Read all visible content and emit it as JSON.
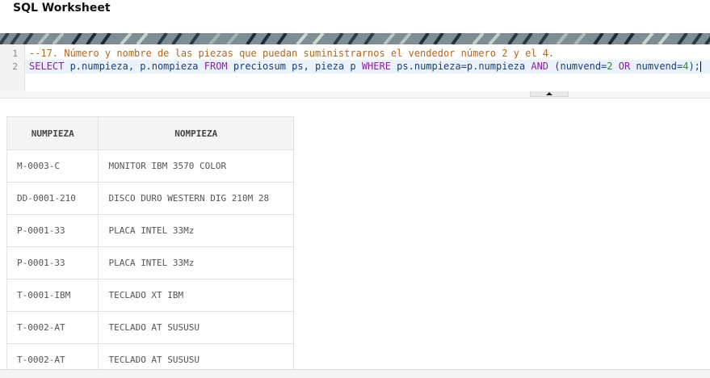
{
  "title": "SQL Worksheet",
  "editor": {
    "line_numbers": [
      "1",
      "2"
    ],
    "line1": "--17. Número y nombre de las piezas que puedan suministrarnos el vendedor número 2 y el 4.",
    "line2": {
      "kw_select": "SELECT",
      "cols": " p.numpieza, p.nompieza ",
      "kw_from": "FROM",
      "tables": " preciosum ps, pieza p ",
      "kw_where": "WHERE",
      "cond1": " ps.numpieza=p.numpieza ",
      "kw_and": "AND",
      "cond2a": " (numvend=",
      "num2": "2",
      "kw_or": " OR ",
      "cond2b": "numvend=",
      "num4": "4",
      "close": ");"
    }
  },
  "results": {
    "columns": [
      "NUMPIEZA",
      "NOMPIEZA"
    ],
    "rows": [
      [
        "M-0003-C",
        "MONITOR IBM 3570 COLOR"
      ],
      [
        "DD-0001-210",
        "DISCO DURO WESTERN DIG 210M 28"
      ],
      [
        "P-0001-33",
        "PLACA INTEL 33Mz"
      ],
      [
        "P-0001-33",
        "PLACA INTEL 33Mz"
      ],
      [
        "T-0001-IBM",
        "TECLADO XT IBM"
      ],
      [
        "T-0002-AT",
        "TECLADO AT SUSUSU"
      ],
      [
        "T-0002-AT",
        "TECLADO AT SUSUSU"
      ]
    ]
  },
  "icons": {
    "split_toggle": "caret-up-icon"
  }
}
